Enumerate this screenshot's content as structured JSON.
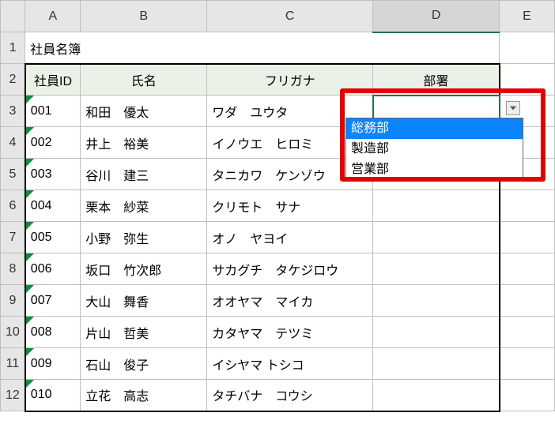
{
  "columns": [
    "A",
    "B",
    "C",
    "D",
    "E"
  ],
  "title": "社員名簿",
  "headers": {
    "id": "社員ID",
    "name": "氏名",
    "kana": "フリガナ",
    "dept": "部署"
  },
  "rows": [
    {
      "n": "3",
      "id": "001",
      "name": "和田　優太",
      "kana": "ワダ　ユウタ",
      "dept": ""
    },
    {
      "n": "4",
      "id": "002",
      "name": "井上　裕美",
      "kana": "イノウエ　ヒロミ",
      "dept": ""
    },
    {
      "n": "5",
      "id": "003",
      "name": "谷川　建三",
      "kana": "タニカワ　ケンゾウ",
      "dept": ""
    },
    {
      "n": "6",
      "id": "004",
      "name": "栗本　紗菜",
      "kana": "クリモト　サナ",
      "dept": ""
    },
    {
      "n": "7",
      "id": "005",
      "name": "小野　弥生",
      "kana": "オノ　ヤヨイ",
      "dept": ""
    },
    {
      "n": "8",
      "id": "006",
      "name": "坂口　竹次郎",
      "kana": "サカグチ　タケジロウ",
      "dept": ""
    },
    {
      "n": "9",
      "id": "007",
      "name": "大山　舞香",
      "kana": "オオヤマ　マイカ",
      "dept": ""
    },
    {
      "n": "10",
      "id": "008",
      "name": "片山　哲美",
      "kana": "カタヤマ　テツミ",
      "dept": ""
    },
    {
      "n": "11",
      "id": "009",
      "name": "石山　俊子",
      "kana": "イシヤマ トシコ",
      "dept": ""
    },
    {
      "n": "12",
      "id": "010",
      "name": "立花　高志",
      "kana": "タチバナ　コウシ",
      "dept": ""
    }
  ],
  "rowhead": {
    "r1": "1",
    "r2": "2"
  },
  "dropdown": {
    "options": [
      "総務部",
      "製造部",
      "営業部"
    ],
    "selected_index": 0
  },
  "active_cell": "D3"
}
